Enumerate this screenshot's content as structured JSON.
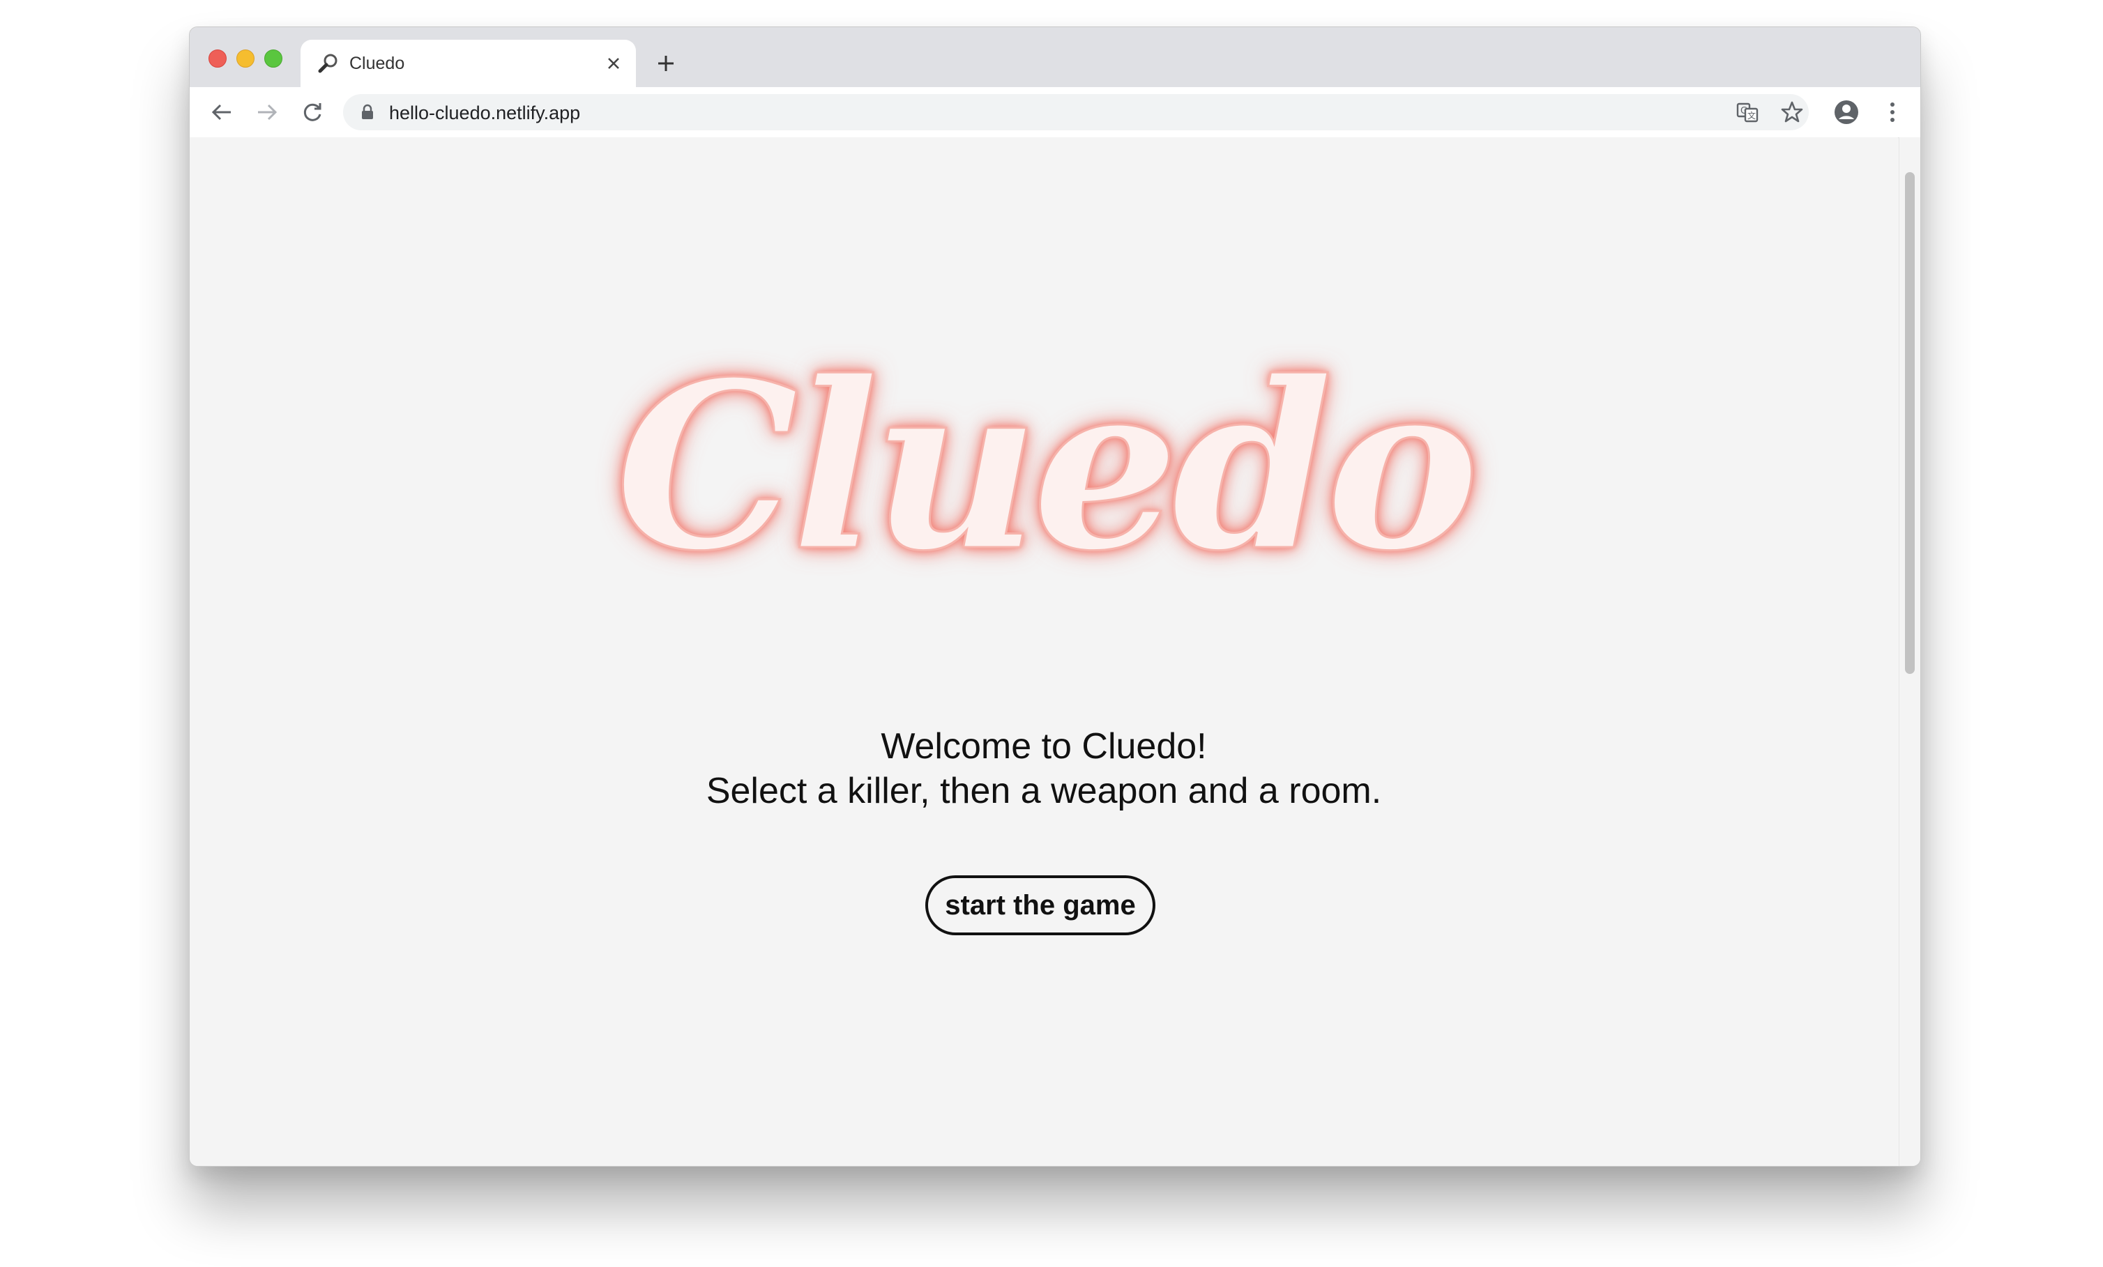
{
  "browser": {
    "tab": {
      "title": "Cluedo",
      "favicon": "magnifying-glass-icon"
    },
    "address_bar": {
      "url": "hello-cluedo.netlify.app"
    },
    "icons": {
      "back": "arrow-left-icon",
      "forward": "arrow-right-icon",
      "reload": "reload-icon",
      "lock": "lock-icon",
      "translate": "translate-icon",
      "bookmark": "star-icon",
      "profile": "account-icon",
      "menu": "kebab-menu-icon"
    }
  },
  "page": {
    "logo_text": "Cluedo",
    "welcome_line1": "Welcome to Cluedo!",
    "welcome_line2": "Select a killer, then a weapon and a room.",
    "start_button_label": "start the game"
  },
  "colors": {
    "page_background": "#f4f4f4",
    "logo_fill": "#fdf1ef",
    "logo_glow": "#f27b70",
    "text": "#111111"
  }
}
